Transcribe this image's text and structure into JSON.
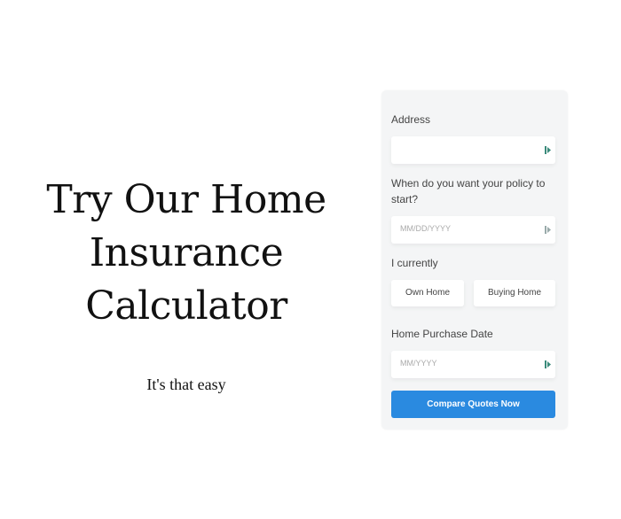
{
  "hero": {
    "title_lines": [
      "Try Our Home",
      "Insurance",
      "Calculator"
    ],
    "subtitle": "It's that easy"
  },
  "form": {
    "address": {
      "label": "Address",
      "value": "",
      "placeholder": "",
      "icon": "autofill-icon"
    },
    "policy_start": {
      "label": "When do you want your policy to start?",
      "value": "",
      "placeholder": "MM/DD/YYYY",
      "icon": "autofill-icon"
    },
    "currently": {
      "label": "I currently",
      "options": [
        "Own Home",
        "Buying Home"
      ]
    },
    "purchase_date": {
      "label": "Home Purchase Date",
      "value": "",
      "placeholder": "MM/YYYY",
      "icon": "autofill-icon"
    },
    "submit_label": "Compare Quotes Now"
  },
  "colors": {
    "accent": "#2a8ae0",
    "panel_bg": "#f4f5f6",
    "icon": "#3a8a7a"
  }
}
